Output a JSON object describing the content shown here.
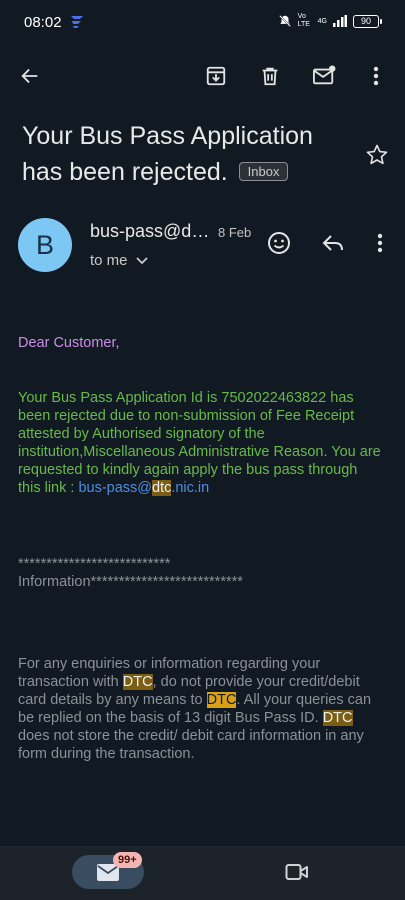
{
  "status_bar": {
    "time": "08:02",
    "battery": "90",
    "network": "4G",
    "volte": "Vo LTE"
  },
  "toolbar": {
    "back": "arrow-back-icon",
    "archive": "archive-icon",
    "delete": "delete-icon",
    "mark_unread": "mark-unread-icon",
    "more": "more-vert-icon"
  },
  "email": {
    "subject": "Your Bus Pass Application has been rejected.",
    "label": "Inbox",
    "sender": "bus-pass@d…",
    "date": "8 Feb",
    "avatar_letter": "B",
    "recipient": "to me",
    "greeting": "Dear Customer,",
    "message_pre": "Your Bus Pass Application Id is 7502022463822 has been rejected due to non-submission of Fee Receipt attested by Authorised signatory of the institution,Miscellaneous Administrative Reason. You are requested to kindly again apply the bus pass through this link : ",
    "link_pre": "bus-pass@",
    "link_highlight": "dtc",
    "link_post": ".nic.in",
    "stars_line": "***************************",
    "info_line": "Information***************************",
    "info_1": "For any enquiries or information regarding your transaction with ",
    "info_dtc_1": "DTC",
    "info_2": ", do not provide your credit/debit card details by any means to ",
    "info_dtc_2": "DTC",
    "info_3": ". All your queries can be replied on the basis of 13 digit Bus Pass ID. ",
    "info_dtc_3": "DTC",
    "info_4": " does not store the credit/ debit card information in any form during the transaction.",
    "dotted_rule": "..................................................."
  },
  "bottom_nav": {
    "mail_badge": "99+"
  },
  "colors": {
    "background": "#111a22",
    "greeting": "#c98ee6",
    "message": "#69b94a",
    "link": "#4e8de0",
    "highlight": "#d9a216",
    "avatar": "#7cc7f3"
  }
}
